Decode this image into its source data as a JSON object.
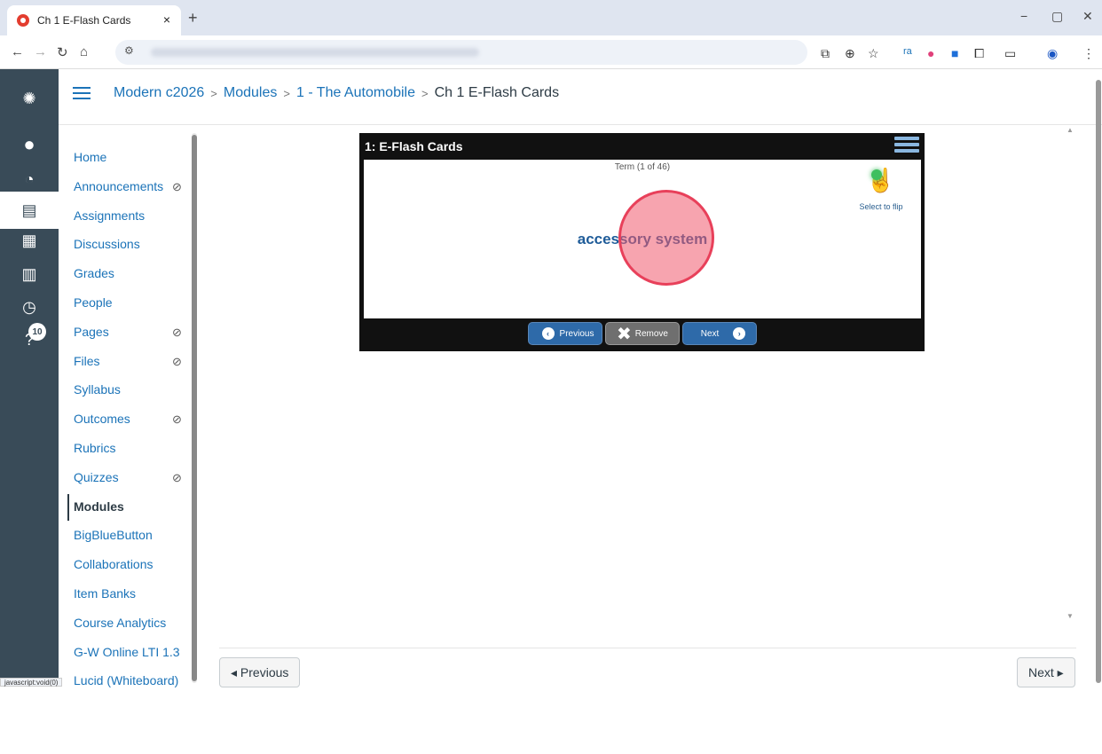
{
  "browser": {
    "tab_title": "Ch 1 E-Flash Cards",
    "tab_close": "×",
    "new_tab": "+",
    "win_min": "−",
    "win_restore": "▢",
    "win_close": "✕",
    "status_bar": "javascript:void(0)"
  },
  "global_nav": {
    "notification_count": "10"
  },
  "breadcrumb": {
    "course": "Modern c2026",
    "modules": "Modules",
    "module": "1 - The Automobile",
    "current": "Ch 1 E-Flash Cards",
    "separator": ">"
  },
  "course_nav": {
    "items": [
      {
        "label": "Home",
        "hidden": false
      },
      {
        "label": "Announcements",
        "hidden": true
      },
      {
        "label": "Assignments",
        "hidden": false
      },
      {
        "label": "Discussions",
        "hidden": false
      },
      {
        "label": "Grades",
        "hidden": false
      },
      {
        "label": "People",
        "hidden": false
      },
      {
        "label": "Pages",
        "hidden": true
      },
      {
        "label": "Files",
        "hidden": true
      },
      {
        "label": "Syllabus",
        "hidden": false
      },
      {
        "label": "Outcomes",
        "hidden": true
      },
      {
        "label": "Rubrics",
        "hidden": false
      },
      {
        "label": "Quizzes",
        "hidden": true
      },
      {
        "label": "Modules",
        "hidden": false,
        "active": true
      },
      {
        "label": "BigBlueButton",
        "hidden": false
      },
      {
        "label": "Collaborations",
        "hidden": false
      },
      {
        "label": "Item Banks",
        "hidden": false
      },
      {
        "label": "Course Analytics",
        "hidden": false
      },
      {
        "label": "G-W Online LTI 1.3",
        "hidden": false
      },
      {
        "label": "Lucid (Whiteboard)",
        "hidden": false
      }
    ]
  },
  "flashcards": {
    "title": "1: E-Flash Cards",
    "counter": "Term (1 of 46)",
    "term": "accessory system",
    "flip_label": "Select to flip",
    "previous_label": "Previous",
    "remove_label": "Remove",
    "next_label": "Next"
  },
  "footer": {
    "previous": "◂ Previous",
    "next": "Next ▸"
  },
  "colors": {
    "link": "#1b73b8",
    "global_nav_bg": "#394b58",
    "term_color": "#1f5c99"
  }
}
